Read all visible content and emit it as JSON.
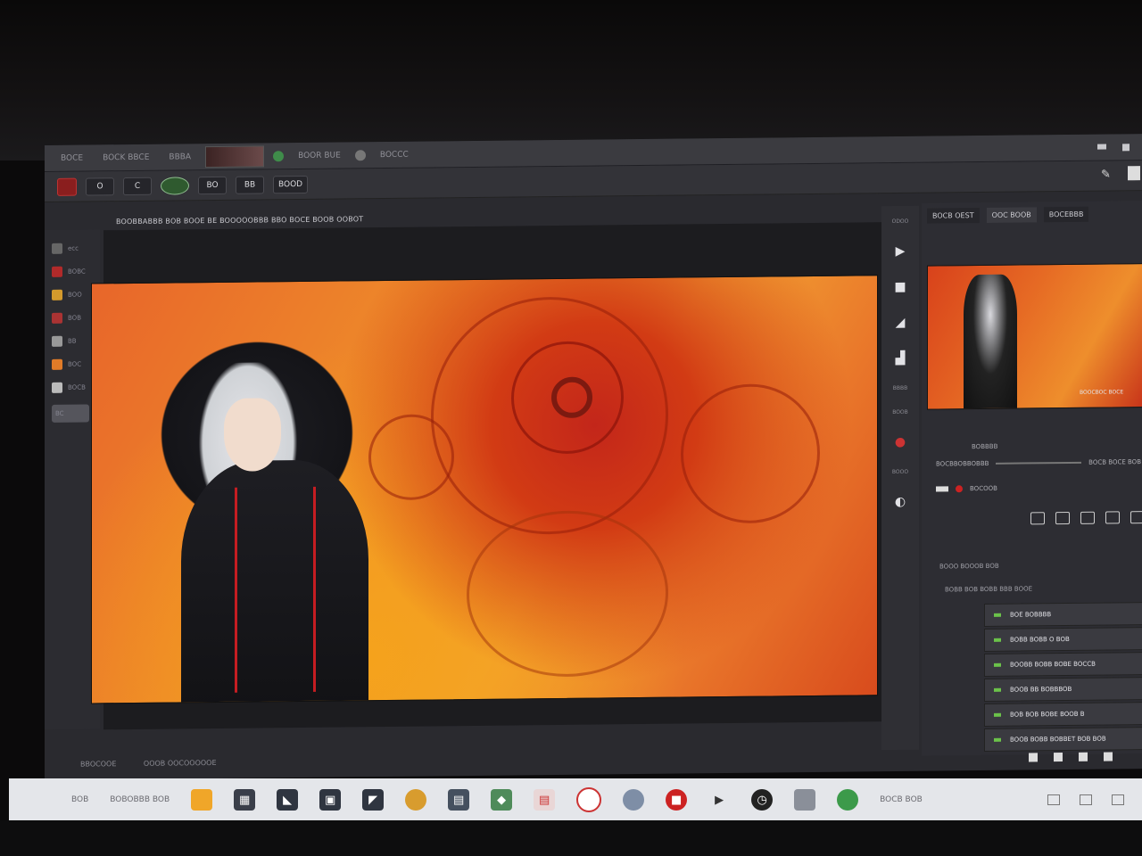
{
  "tabbar": {
    "tabs": [
      "BOCE",
      "BOCK BBCE",
      "BBBA",
      "BOOR BUE",
      "BOCCC"
    ],
    "window_controls": [
      "minimize",
      "close"
    ]
  },
  "toolbar": {
    "items": [
      "O",
      "C",
      "BO",
      "BB",
      "BOOD"
    ],
    "accent_red": "#8a1e1e"
  },
  "pathbar": {
    "text": "BOOBBABBB BOB BOOE BE BOOOOOBBB BBO BOCE BOOB OOBOT"
  },
  "left_tools": {
    "items": [
      "ecc",
      "BOBC",
      "BOO",
      "BOB",
      "BB",
      "BOC",
      "BOCB",
      "BC"
    ]
  },
  "canvas": {
    "status_left": "BBOCOOE",
    "status_right": "OOOB OOCOOOOOE"
  },
  "right_icons": {
    "top_label": "ODOO",
    "labels": [
      "BBBB",
      "BOOB",
      "BOOO"
    ]
  },
  "right_panel": {
    "tabs": [
      "BOCB OEST",
      "OOC BOOB",
      "BOCEBBB"
    ],
    "preview_caption": "BOOCBOC BOCE",
    "section_label": "BOBBBB",
    "row1_left": "BOCBBOBBOBBB",
    "row1_right": "BOCB BOCE BOB",
    "row2_text": "BOCOOB",
    "crumb": "BOOO BOOOB BOB",
    "crumb2": "BOBB BOB BOBB BBB BOOE",
    "layers": [
      "BOE BOBBBB",
      "BOBB BOBB O BOB",
      "BOOBB BOBB BOBE BOCCB",
      "BOOB BB BOBBBOB",
      "BOB BOB BOBE BOOB B",
      "BOOB BOBB BOBBET BOB BOB"
    ]
  },
  "taskbar": {
    "left_text_1": "BOB",
    "left_text_2": "BOBOBBB BOB",
    "right_text": "BOCB BOB",
    "icon_names": [
      "grid-icon",
      "folder-icon",
      "image-icon",
      "arrow-icon",
      "chrome-icon",
      "calendar-icon",
      "bird-icon",
      "news-icon",
      "circle-icon",
      "globe-icon",
      "red-app-icon",
      "play-icon",
      "clock-icon",
      "system-icon",
      "leaf-icon"
    ]
  }
}
